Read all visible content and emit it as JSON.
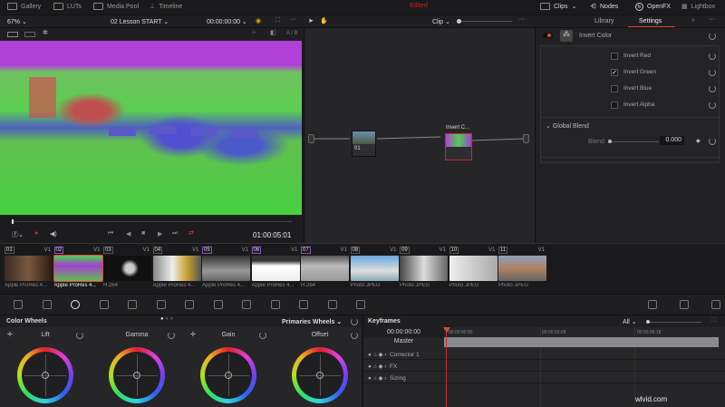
{
  "topbar": {
    "gallery": "Gallery",
    "luts": "LUTs",
    "media_pool": "Media Pool",
    "timeline": "Timeline",
    "status": "Edited",
    "clips": "Clips",
    "nodes": "Nodes",
    "openfx": "OpenFX",
    "lightbox": "Lightbox"
  },
  "viewer": {
    "zoom": "67%",
    "timeline_name": "02 Lesson START",
    "timecode": "00:00:00:00",
    "ab": "A / B",
    "playhead_timecode": "01:00:05:01"
  },
  "node_editor": {
    "mode": "Clip",
    "node1_label": "01",
    "node2_label": "Invert C..."
  },
  "right_panel": {
    "tabs": [
      "Library",
      "Settings"
    ],
    "active_tab": "Settings",
    "effect_name": "Invert Color",
    "options": [
      {
        "label": "Invert Red",
        "checked": false
      },
      {
        "label": "Invert Green",
        "checked": true
      },
      {
        "label": "Invert Blue",
        "checked": false
      },
      {
        "label": "Invert Alpha",
        "checked": false
      }
    ],
    "section": "Global Blend",
    "blend_label": "Blend",
    "blend_value": "0.000"
  },
  "clips": [
    {
      "num": "01",
      "track": "V1",
      "codec": "Apple ProRes 4..."
    },
    {
      "num": "02",
      "track": "V1",
      "codec": "Apple ProRes 4..."
    },
    {
      "num": "03",
      "track": "V1",
      "codec": "H.264"
    },
    {
      "num": "04",
      "track": "V1",
      "codec": "Apple ProRes 4..."
    },
    {
      "num": "05",
      "track": "V1",
      "codec": "Apple ProRes 4..."
    },
    {
      "num": "06",
      "track": "V1",
      "codec": "Apple ProRes 4..."
    },
    {
      "num": "07",
      "track": "V1",
      "codec": "H.264"
    },
    {
      "num": "08",
      "track": "V1",
      "codec": "Photo JPEG"
    },
    {
      "num": "09",
      "track": "V1",
      "codec": "Photo JPEG"
    },
    {
      "num": "10",
      "track": "V1",
      "codec": "Photo JPEG"
    },
    {
      "num": "11",
      "track": "V1",
      "codec": "Photo JPEG"
    }
  ],
  "color_wheels": {
    "title": "Color Wheels",
    "mode": "Primaries Wheels",
    "wheels": [
      "Lift",
      "Gamma",
      "Gain",
      "Offset"
    ]
  },
  "keyframes": {
    "title": "Keyframes",
    "filter": "All",
    "timecode": "00:00:00:00",
    "ruler": [
      "00:00:00:00",
      "00:00:03:09",
      "00:00:06:18"
    ],
    "tracks": [
      "Master",
      "Corrector 1",
      "FX",
      "Sizing"
    ]
  },
  "watermark": "wlvid.com",
  "colors": {
    "accent": "#e0483a",
    "status": "#c0282a"
  }
}
